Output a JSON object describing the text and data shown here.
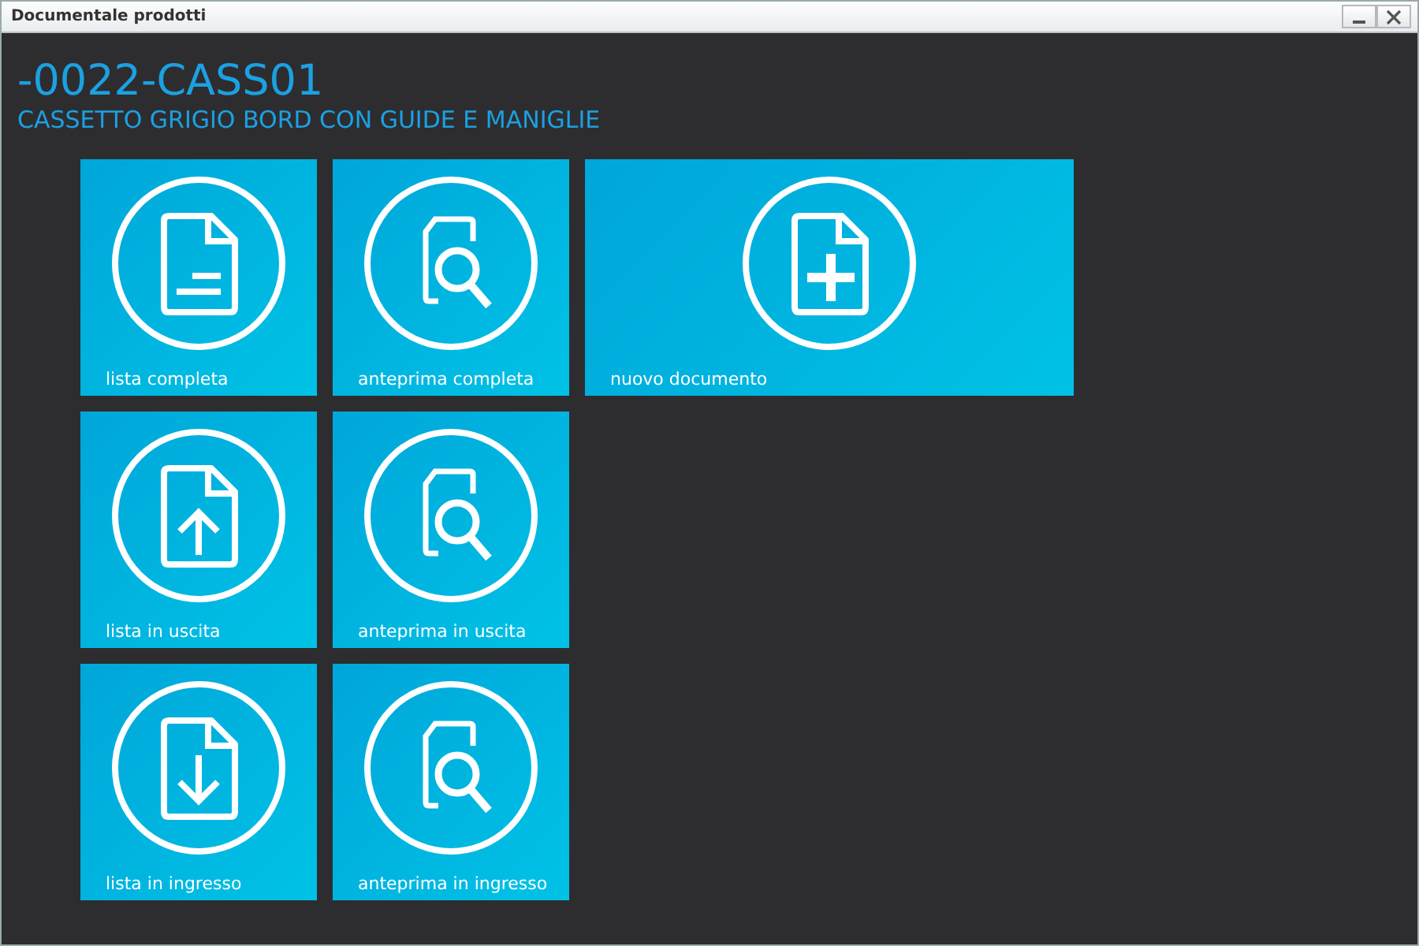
{
  "window": {
    "title": "Documentale prodotti",
    "controls": [
      {
        "kind": "minimize"
      },
      {
        "kind": "close"
      }
    ]
  },
  "header": {
    "code": "-0022-CASS01",
    "description": "CASSETTO GRIGIO BORD CON GUIDE E MANIGLIE"
  },
  "tile_rows": [
    [
      {
        "label": "lista completa",
        "kind": "document"
      },
      {
        "label": "anteprima completa",
        "kind": "preview"
      },
      {
        "label": "nuovo documento",
        "kind": "new"
      }
    ],
    [
      {
        "label": "lista in uscita",
        "kind": "upload"
      },
      {
        "label": "anteprima in uscita",
        "kind": "preview"
      }
    ],
    [
      {
        "label": "lista in ingresso",
        "kind": "download"
      },
      {
        "label": "anteprima in ingresso",
        "kind": "preview"
      }
    ]
  ]
}
